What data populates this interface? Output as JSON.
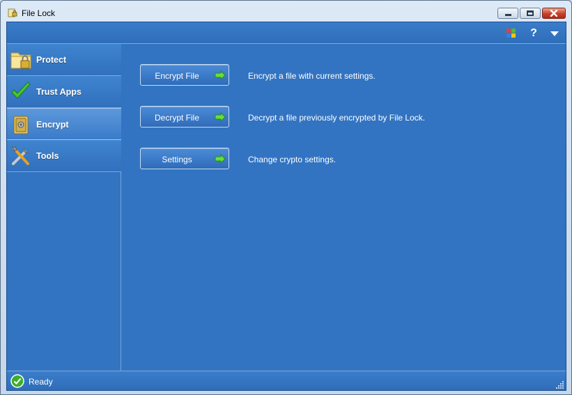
{
  "window": {
    "title": "File Lock",
    "icon": "file-lock-app-icon",
    "controls": [
      "minimize",
      "maximize",
      "close"
    ]
  },
  "toolbar": {
    "icons": [
      "windows-logo-icon",
      "help-icon",
      "dropdown-menu-icon"
    ],
    "help_label": "?"
  },
  "sidebar": {
    "items": [
      {
        "label": "Protect",
        "icon": "folder-lock-icon",
        "selected": false
      },
      {
        "label": "Trust Apps",
        "icon": "checkmark-icon",
        "selected": false
      },
      {
        "label": "Encrypt",
        "icon": "safe-icon",
        "selected": true
      },
      {
        "label": "Tools",
        "icon": "tools-icon",
        "selected": false
      }
    ]
  },
  "main": {
    "actions": [
      {
        "label": "Encrypt File",
        "description": "Encrypt a file with current settings."
      },
      {
        "label": "Decrypt File",
        "description": "Decrypt a file previously encrypted by File Lock."
      },
      {
        "label": "Settings",
        "description": "Change crypto settings."
      }
    ]
  },
  "status": {
    "text": "Ready",
    "icon": "ok-check-icon"
  },
  "colors": {
    "panel_blue": "#3274c2",
    "arrow_green": "#66dd44",
    "close_red": "#c6412b"
  }
}
